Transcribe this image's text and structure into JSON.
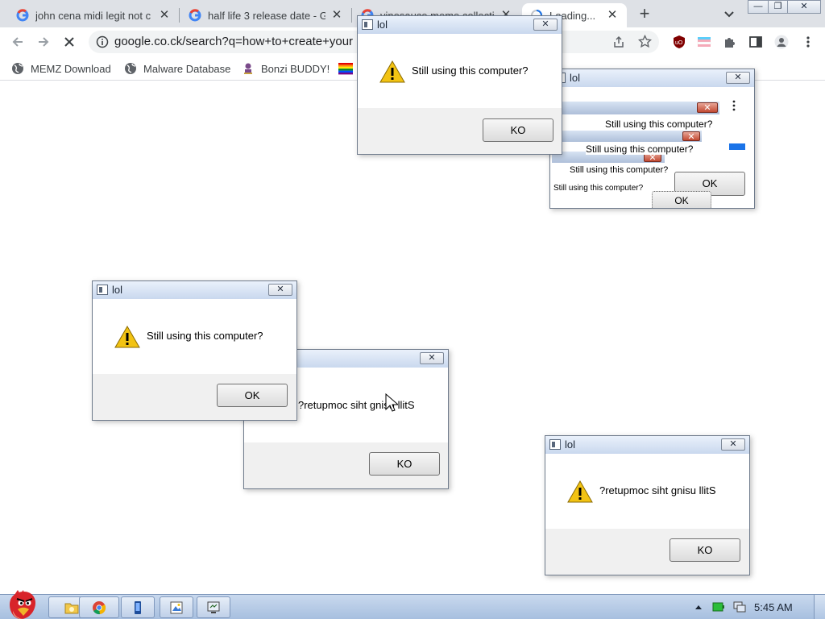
{
  "browser": {
    "tabs": [
      {
        "title": "john cena midi legit not c"
      },
      {
        "title": "half life 3 release date - G"
      },
      {
        "title": "vinesauce meme collectio"
      },
      {
        "title": "Loading..."
      }
    ],
    "new_tab": "+",
    "close_glyph": "✕",
    "url": "google.co.ck/search?q=how+to+create+your",
    "bookmarks": [
      {
        "label": "MEMZ Download"
      },
      {
        "label": "Malware Database"
      },
      {
        "label": "Bonzi BUDDY!"
      }
    ],
    "window_controls": {
      "minimize": "—",
      "maximize": "❐",
      "close": "✕"
    }
  },
  "dialogs": {
    "top": {
      "title": "lol",
      "message": "Still using this computer?",
      "button": "KO"
    },
    "stack": {
      "title": "lol",
      "lines": [
        "Still using this computer?",
        "Still using this computer?",
        "Still using this computer?",
        "Still using this computer?"
      ],
      "buttons": [
        "OK",
        "OK"
      ]
    },
    "left": {
      "title": "lol",
      "message": "Still using this computer?",
      "button": "OK"
    },
    "middle": {
      "title": "",
      "message": "?retupmoc siht gnisu llitS",
      "button": "KO"
    },
    "bottom_right": {
      "title": "lol",
      "message": "?retupmoc siht gnisu llitS",
      "button": "KO"
    }
  },
  "taskbar": {
    "clock": "5:45 AM"
  },
  "colors": {
    "warning": "#f2c313",
    "chrome_tabstrip": "#dee1e6",
    "taskbar": "#b6cbe6"
  },
  "icons": [
    "google-favicon",
    "globe-icon",
    "bonzi-icon",
    "rainbow-flag-icon",
    "warning-icon",
    "angry-bird-start-icon",
    "chrome-icon"
  ]
}
